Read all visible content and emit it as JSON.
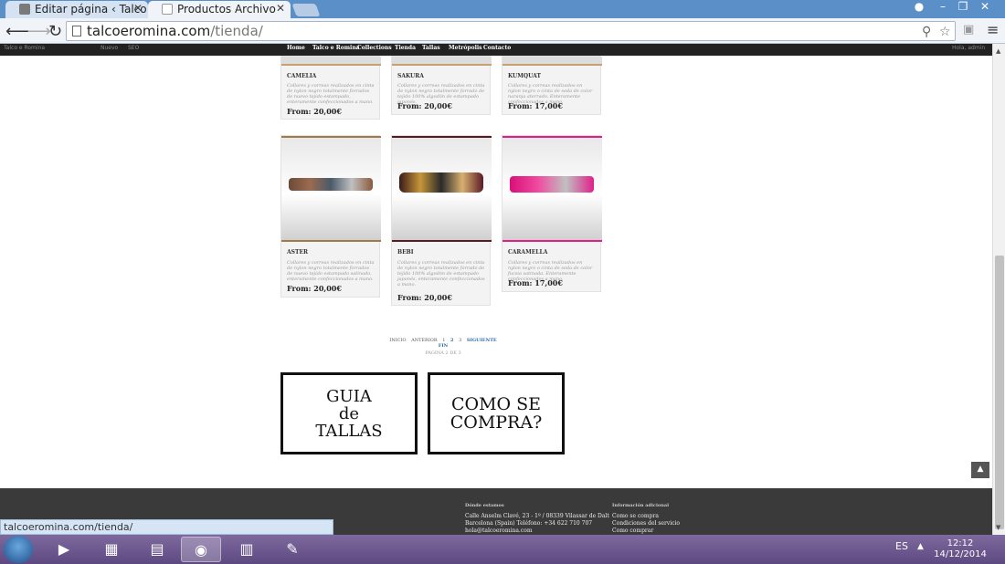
{
  "browser": {
    "tabs": [
      {
        "title": "Editar página ‹ Talco e Ro",
        "active": false
      },
      {
        "title": "Productos Archivo",
        "active": true
      }
    ],
    "url": {
      "host": "talcoeromina.com",
      "path": "/tienda/"
    },
    "status_url": "talcoeromina.com/tienda/"
  },
  "site": {
    "nav": [
      "Home",
      "Talco e Romina",
      "Collections",
      "Tienda",
      "Tallas",
      "Metrópolis",
      "Contacto"
    ],
    "admin_bar": {
      "left": "Talco e Romina",
      "new": "Nuevo",
      "seo": "SEO",
      "right": "Hola, admin"
    }
  },
  "products_row1": [
    {
      "name": "CAMELIA",
      "desc": "Collares y correas realizados en cinta de nylon negro totalmente forrados de nuevo tejido estampado, enteramente confeccionados a mano.",
      "price": "From: 20,00€"
    },
    {
      "name": "SAKURA",
      "desc": "Collares y correas realizados en cinta de nylon negro totalmente forrado de tejido 100% algodón de estampado japonés.",
      "price": "From: 20,00€"
    },
    {
      "name": "KUMQUAT",
      "desc": "Collares y correas realizados en nylon negro o cinta de seda de color naranja aterrado. Enteramente confeccionados a mano.",
      "price": "From: 17,00€"
    }
  ],
  "products_row2": [
    {
      "name": "ASTER",
      "desc": "Collares y correas realizados en cinta de nylon negro totalmente forrados de nuevo tejido estampado satinado, enteramente confeccionados a mano.",
      "price": "From: 20,00€",
      "color": "#8a5a3c"
    },
    {
      "name": "BEBI",
      "desc": "Collares y correas realizados en cinta de nylon negro totalmente forrado de tejido 100% algodón de estampado japonés, enteramente confeccionados a mano.",
      "price": "From: 20,00€",
      "color": "#5a1a24"
    },
    {
      "name": "CARAMELLA",
      "desc": "Collares y correas realizados en nylon negro o cinta de seda de color fucsia satinada. Enteramente confeccionados a mano.",
      "price": "From: 17,00€",
      "color": "#e0208a"
    }
  ],
  "pagination": {
    "links": [
      "INICIO",
      "ANTERIOR",
      "1",
      "2",
      "3",
      "SIGUIENTE",
      "FIN"
    ],
    "current": "2",
    "info": "PÁGINA 2 DE 3"
  },
  "cta": {
    "sizes": [
      "GUIA",
      "de",
      "TALLAS"
    ],
    "howto": [
      "COMO SE",
      "COMPRA?"
    ]
  },
  "footer": {
    "contact_heading": "Dónde estamos",
    "contact_lines": [
      "Calle Anselm Clavé, 23 - 1º / 08339 Vilassar de Dalt",
      "Barcelona (Spain) Teléfono: +34 622 710 707",
      "hola@talcoeromina.com"
    ],
    "info_heading": "Información adicional",
    "info_links": [
      "Como se compra",
      "Condiciones del servicio",
      "Como comprar"
    ]
  },
  "taskbar": {
    "lang": "ES",
    "time": "12:12",
    "date": "14/12/2014"
  }
}
